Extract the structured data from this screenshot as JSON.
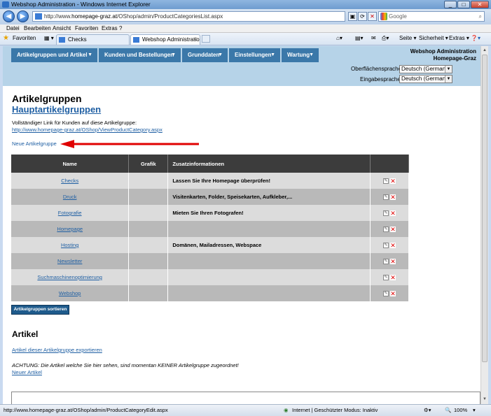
{
  "window": {
    "title": "Webshop Administration - Windows Internet Explorer",
    "controls": [
      "_",
      "□",
      "✕"
    ]
  },
  "browser": {
    "back_icon": "back-arrow-icon",
    "forward_icon": "forward-arrow-icon",
    "address_prefix": "http://www.",
    "address_domain": "homepage-graz.at",
    "address_path": "/OShop/admin/ProductCategoriesList.aspx",
    "search_placeholder": "Google",
    "menu": [
      "Datei",
      "Bearbeiten",
      "Ansicht",
      "Favoriten",
      "Extras",
      "?"
    ],
    "favorites_label": "Favoriten",
    "tabs": [
      {
        "label": "Checks",
        "active": false
      },
      {
        "label": "Webshop Administration",
        "active": true
      }
    ],
    "commands": [
      "Seite ▾",
      "Sicherheit ▾",
      "Extras ▾"
    ],
    "status_url": "http://www.homepage-graz.at/OShop/admin/ProductCategoryEdit.aspx",
    "status_zone": "Internet | Geschützter Modus: Inaktiv",
    "zoom": "100%"
  },
  "app": {
    "nav": [
      {
        "label": "Artikelgruppen und Artikel"
      },
      {
        "label": "Kunden und Bestellungen"
      },
      {
        "label": "Grunddaten"
      },
      {
        "label": "Einstellungen"
      },
      {
        "label": "Wartung"
      }
    ],
    "shop_title": "Webshop Administration",
    "shop_subtitle": "Homepage-Graz",
    "ui_language_label": "Oberflächensprache:",
    "ui_language_value": "Deutsch (German)",
    "input_language_label": "Eingabesprache:",
    "input_language_value": "Deutsch (German)"
  },
  "page": {
    "heading": "Artikelgruppen",
    "main_groups_link": "Hauptartikelgruppen",
    "full_link_label": "Vollständiger Link für Kunden auf diese Artikelgruppe:",
    "full_link_url": "http://www.homepage-graz.at/OShop/ViewProductCategory.aspx",
    "new_group_link": "Neue Artikelgruppe",
    "table": {
      "headers": [
        "Name",
        "Grafik",
        "Zusatzinformationen",
        ""
      ],
      "rows": [
        {
          "name": "Checks",
          "info": "Lassen Sie Ihre Homepage überprüfen!"
        },
        {
          "name": "Druck",
          "info": "Visitenkarten, Folder, Speisekarten, Aufkleber,..."
        },
        {
          "name": "Fotografie",
          "info": "Mieten Sie Ihren Fotografen!"
        },
        {
          "name": "Homepage",
          "info": ""
        },
        {
          "name": "Hosting",
          "info": "Domänen, Mailadressen, Webspace"
        },
        {
          "name": "Newsletter",
          "info": ""
        },
        {
          "name": "Suchmaschinenoptimierung",
          "info": ""
        },
        {
          "name": "Webshop",
          "info": ""
        }
      ]
    },
    "sort_button": "Artikelgruppen sortieren",
    "articles_heading": "Artikel",
    "export_link": "Artikel dieser Artikelgruppe exportieren",
    "warning": "ACHTUNG: Die Artikel welche Sie hier sehen, sind momentan KEINER Artikelgruppe zugeordnet!",
    "new_article_link": "Neuer Artikel"
  },
  "colors": {
    "nav_bg": "#3b78a9",
    "header_bg": "#b6d3e8",
    "table_header": "#3c3c3c",
    "row_light": "#dcdcdc",
    "row_dark": "#b9b9b9",
    "link": "#1f5fa3",
    "annotation_arrow": "#e00000"
  }
}
